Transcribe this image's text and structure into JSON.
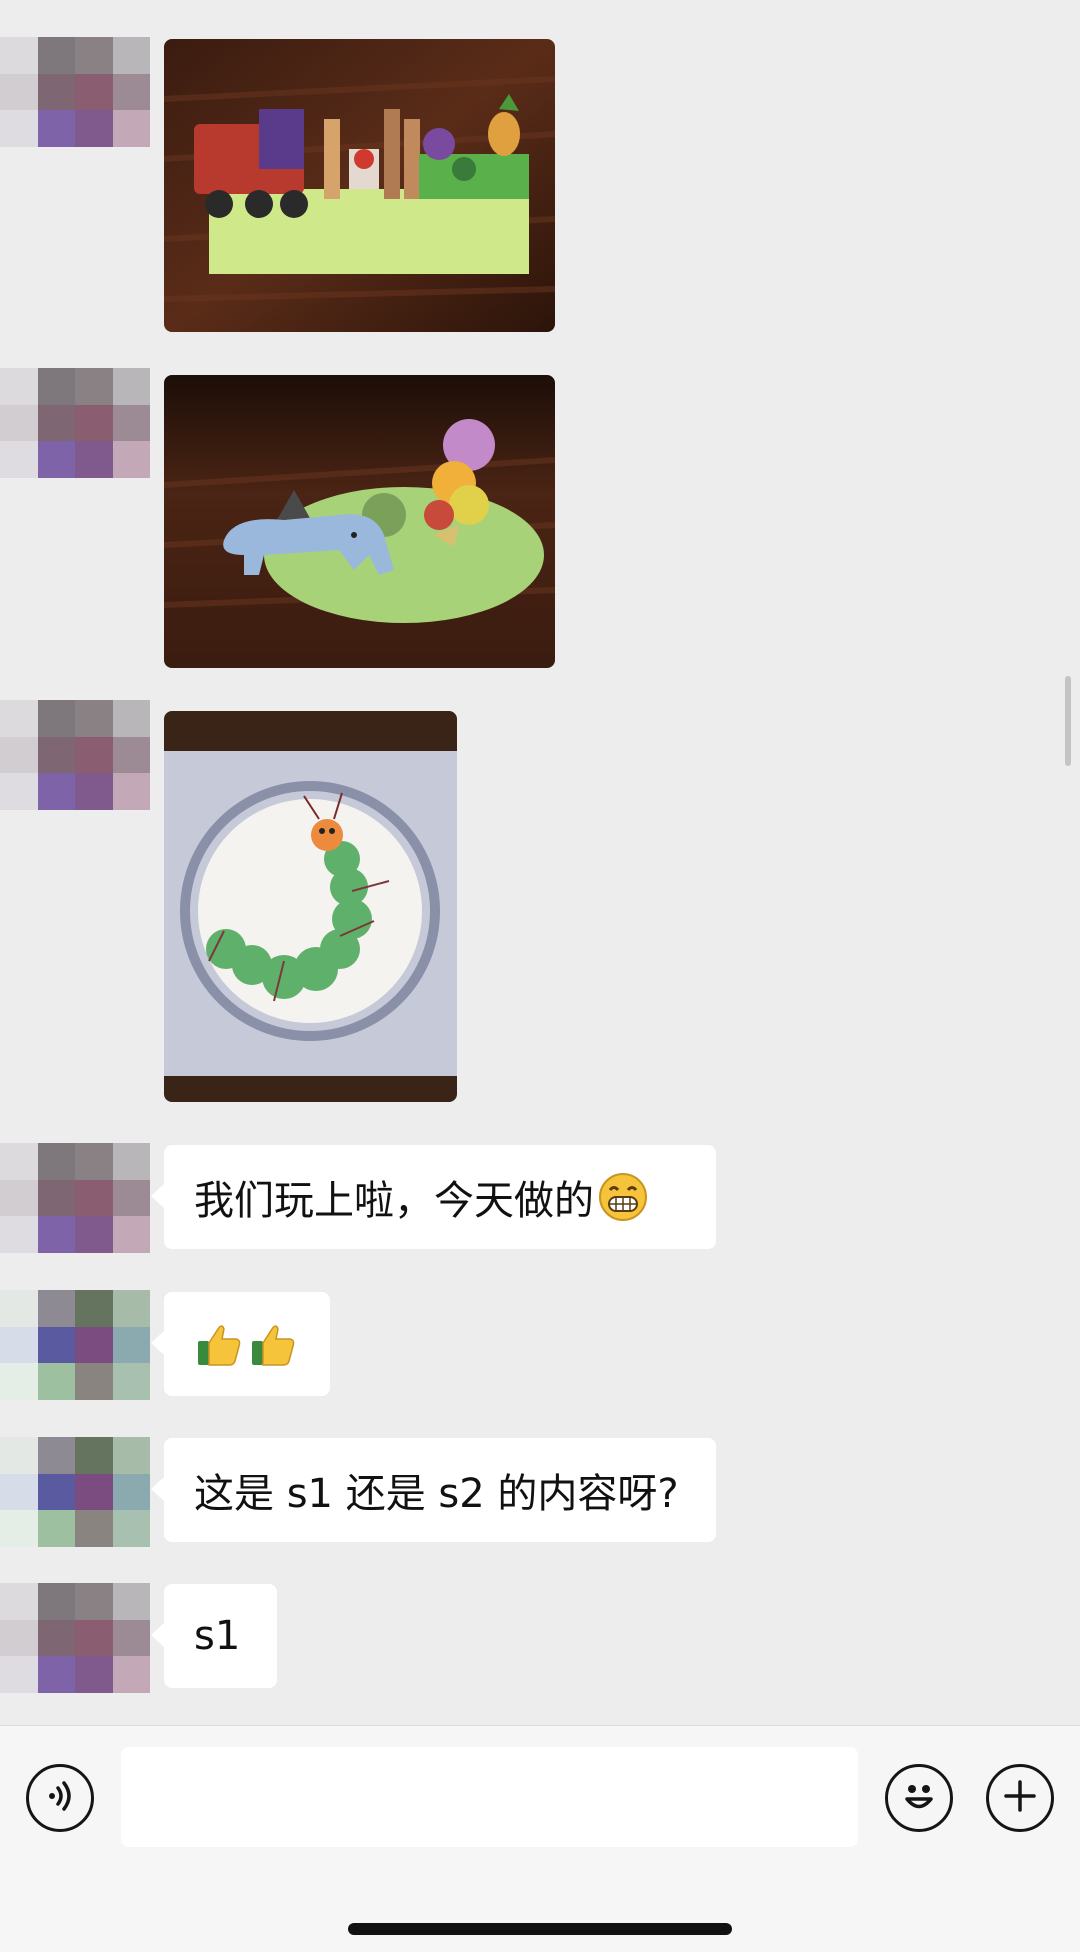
{
  "chat": {
    "messages": [
      {
        "type": "image",
        "content": "paper-craft-train-fruits"
      },
      {
        "type": "image",
        "content": "paper-craft-elephant-balloons"
      },
      {
        "type": "image",
        "content": "caterpillar-painting"
      },
      {
        "type": "text",
        "text": "我们玩上啦，今天做的",
        "emoji": "grinning-face-icon"
      },
      {
        "type": "emoji",
        "emoji": [
          "thumbs-up-icon",
          "thumbs-up-icon"
        ]
      },
      {
        "type": "text",
        "text": "这是 s1 还是 s2 的内容呀?"
      },
      {
        "type": "text",
        "text": "s1"
      }
    ]
  },
  "input_bar": {
    "voice_icon": "voice-icon",
    "emoji_icon": "smiley-icon",
    "more_icon": "plus-icon",
    "input_value": ""
  },
  "colors": {
    "background": "#ededed",
    "bubble": "#ffffff",
    "bottom_bar": "#f6f6f6"
  }
}
